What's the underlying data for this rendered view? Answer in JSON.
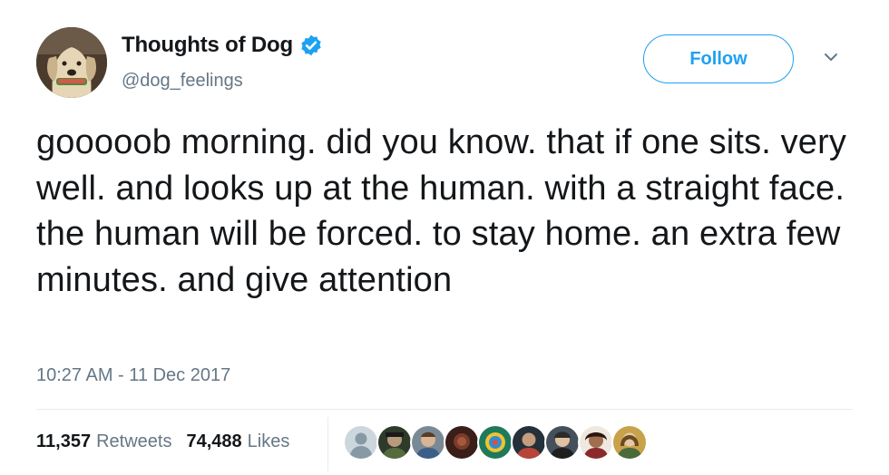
{
  "tweet": {
    "display_name": "Thoughts of Dog",
    "handle": "@dog_feelings",
    "verified_icon": "verified-badge-icon",
    "follow_label": "Follow",
    "caret_icon": "chevron-down-icon",
    "text": "gooooob morning. did you know. that if one sits. very well. and looks up at the human. with a straight face. the human will be forced. to stay home. an extra few minutes. and give attention",
    "timestamp": "10:27 AM - 11 Dec 2017",
    "retweets": {
      "count": "11,357",
      "label": "Retweets"
    },
    "likes": {
      "count": "74,488",
      "label": "Likes"
    },
    "likers": [
      {
        "icon": "default-avatar-icon"
      },
      {
        "icon": "user-avatar-icon"
      },
      {
        "icon": "user-avatar-icon"
      },
      {
        "icon": "user-avatar-icon"
      },
      {
        "icon": "user-avatar-icon"
      },
      {
        "icon": "user-avatar-icon"
      },
      {
        "icon": "user-avatar-icon"
      },
      {
        "icon": "user-avatar-icon"
      },
      {
        "icon": "user-avatar-icon"
      }
    ]
  },
  "colors": {
    "accent": "#1da1f2",
    "text": "#14171a",
    "secondary": "#657786",
    "divider": "#e6ecf0"
  }
}
